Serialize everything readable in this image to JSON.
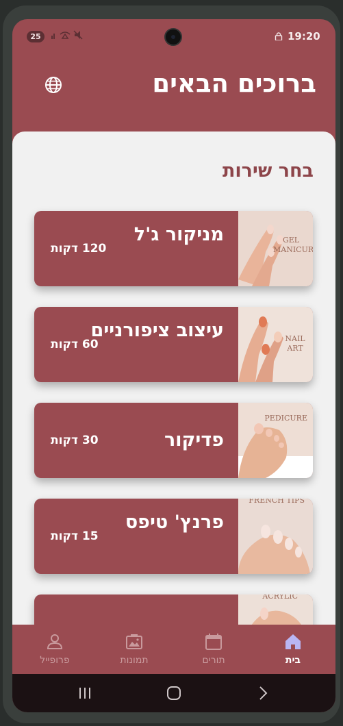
{
  "status_bar": {
    "notification_count": "25",
    "time": "19:20"
  },
  "header": {
    "title": "ברוכים הבאים",
    "language_icon": "globe-icon"
  },
  "main": {
    "section_title": "בחר שירות",
    "services": [
      {
        "name": "מניקור ג'ל",
        "duration": "120 דקות",
        "image_text": "GEL MANICURE"
      },
      {
        "name": "עיצוב ציפורניים",
        "duration": "60 דקות",
        "image_text": "NAIL ART"
      },
      {
        "name": "פדיקור",
        "duration": "30 דקות",
        "image_text": "PEDICURE"
      },
      {
        "name": "פרנץ' טיפס",
        "duration": "15 דקות",
        "image_text": "FRENCH TIPS"
      },
      {
        "name": "",
        "duration": "",
        "image_text": "ACRYLIC"
      }
    ]
  },
  "bottom_nav": {
    "items": [
      {
        "label": "בית",
        "icon": "home-icon",
        "active": true
      },
      {
        "label": "תורים",
        "icon": "calendar-icon",
        "active": false
      },
      {
        "label": "תמונות",
        "icon": "photos-icon",
        "active": false
      },
      {
        "label": "פרופייל",
        "icon": "person-icon",
        "active": false
      }
    ]
  },
  "colors": {
    "primary": "#9a4b51",
    "background": "#f1f1f1",
    "title_text": "#8d454a",
    "active_nav_icon": "#b9b6f3"
  }
}
